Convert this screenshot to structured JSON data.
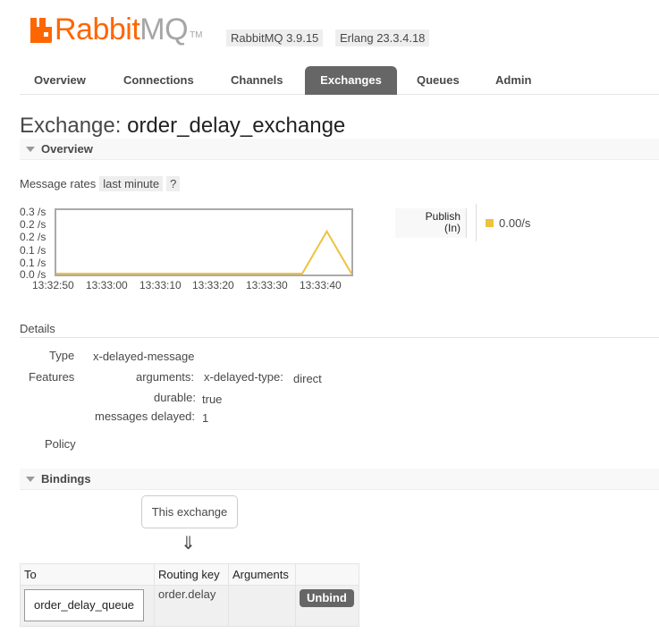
{
  "header": {
    "logo_rabbit": "Rabbit",
    "logo_mq": "MQ",
    "logo_tm": "TM",
    "version_rabbitmq": "RabbitMQ 3.9.15",
    "version_erlang": "Erlang 23.3.4.18"
  },
  "tabs": [
    {
      "label": "Overview"
    },
    {
      "label": "Connections"
    },
    {
      "label": "Channels"
    },
    {
      "label": "Exchanges"
    },
    {
      "label": "Queues"
    },
    {
      "label": "Admin"
    }
  ],
  "active_tab": "Exchanges",
  "page": {
    "title_prefix": "Exchange:",
    "title_name": "order_delay_exchange"
  },
  "overview": {
    "section_label": "Overview",
    "message_rates_label": "Message rates",
    "range_chip": "last minute",
    "help_chip": "?",
    "publish_label_line1": "Publish",
    "publish_label_line2": "(In)",
    "publish_rate": "0.00/s"
  },
  "chart_data": {
    "type": "line",
    "y_tick_labels": [
      "0.3 /s",
      "0.2 /s",
      "0.2 /s",
      "0.1 /s",
      "0.1 /s",
      "0.0 /s"
    ],
    "x_tick_labels": [
      "13:32:50",
      "13:33:00",
      "13:33:10",
      "13:33:20",
      "13:33:30",
      "13:33:40"
    ],
    "ylim": [
      0,
      0.3
    ],
    "series": [
      {
        "name": "Publish (In)",
        "color": "#edc240",
        "x": [
          "13:32:45",
          "13:32:50",
          "13:33:00",
          "13:33:10",
          "13:33:20",
          "13:33:30",
          "13:33:35",
          "13:33:40",
          "13:33:45"
        ],
        "values": [
          0,
          0,
          0,
          0,
          0,
          0,
          0,
          0.2,
          0
        ]
      }
    ],
    "grid": false,
    "legend": "right"
  },
  "details": {
    "title": "Details",
    "type_label": "Type",
    "type_value": "x-delayed-message",
    "features_label": "Features",
    "arguments_key": "arguments:",
    "arguments_subkey": "x-delayed-type:",
    "arguments_value": "direct",
    "durable_key": "durable:",
    "durable_value": "true",
    "delayed_key": "messages delayed:",
    "delayed_value": "1",
    "policy_label": "Policy"
  },
  "bindings": {
    "section_label": "Bindings",
    "this_exchange": "This exchange",
    "arrow": "⇓",
    "headers": [
      "To",
      "Routing key",
      "Arguments",
      ""
    ],
    "rows": [
      {
        "to": "order_delay_queue",
        "routing_key": "order.delay",
        "arguments": "",
        "action": "Unbind"
      }
    ]
  }
}
